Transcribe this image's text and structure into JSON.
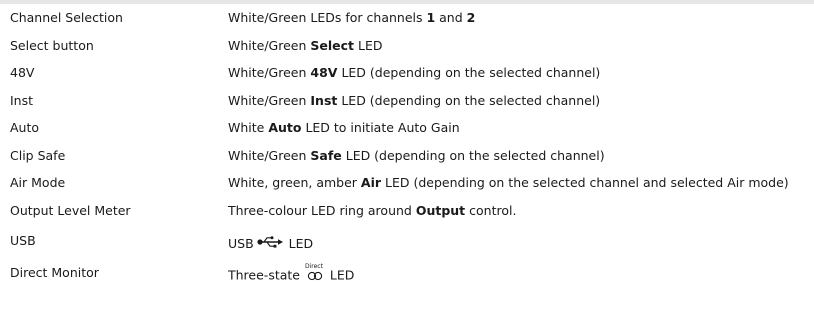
{
  "rows": [
    {
      "feature": "Channel Selection",
      "description": {
        "prefix": "White/Green LEDs for channels ",
        "bold1": "1",
        "mid": " and ",
        "bold2": "2"
      }
    },
    {
      "feature": "Select button",
      "description": {
        "prefix": "White/Green ",
        "bold": "Select",
        "suffix": " LED"
      }
    },
    {
      "feature": "48V",
      "description": {
        "prefix": "White/Green ",
        "bold": "48V",
        "suffix": " LED (depending on the selected channel)"
      }
    },
    {
      "feature": "Inst",
      "description": {
        "prefix": "White/Green ",
        "bold": "Inst",
        "suffix": " LED (depending on the selected channel)"
      }
    },
    {
      "feature": "Auto",
      "description": {
        "prefix": "White ",
        "bold": "Auto",
        "suffix": " LED to initiate Auto Gain"
      }
    },
    {
      "feature": "Clip Safe",
      "description": {
        "prefix": "White/Green ",
        "bold": "Safe",
        "suffix": " LED (depending on the selected channel)"
      }
    },
    {
      "feature": "Air Mode",
      "description": {
        "prefix": "White, green, amber ",
        "bold": "Air",
        "suffix": " LED (depending on the selected channel and selected Air mode)"
      }
    },
    {
      "feature": "Output Level Meter",
      "description": {
        "prefix": "Three-colour LED ring around ",
        "bold": "Output",
        "suffix": " control."
      }
    },
    {
      "feature": "USB",
      "description": {
        "prefix": "USB",
        "icon": "usb-icon",
        "suffix": " LED"
      }
    },
    {
      "feature": "Direct Monitor",
      "description": {
        "prefix": "Three-state ",
        "icon": "direct-monitor-icon",
        "icon_label": "Direct",
        "suffix": " LED"
      }
    }
  ],
  "colors": {
    "text": "#1a1a1a",
    "top_rule": "#e6e6e6"
  }
}
